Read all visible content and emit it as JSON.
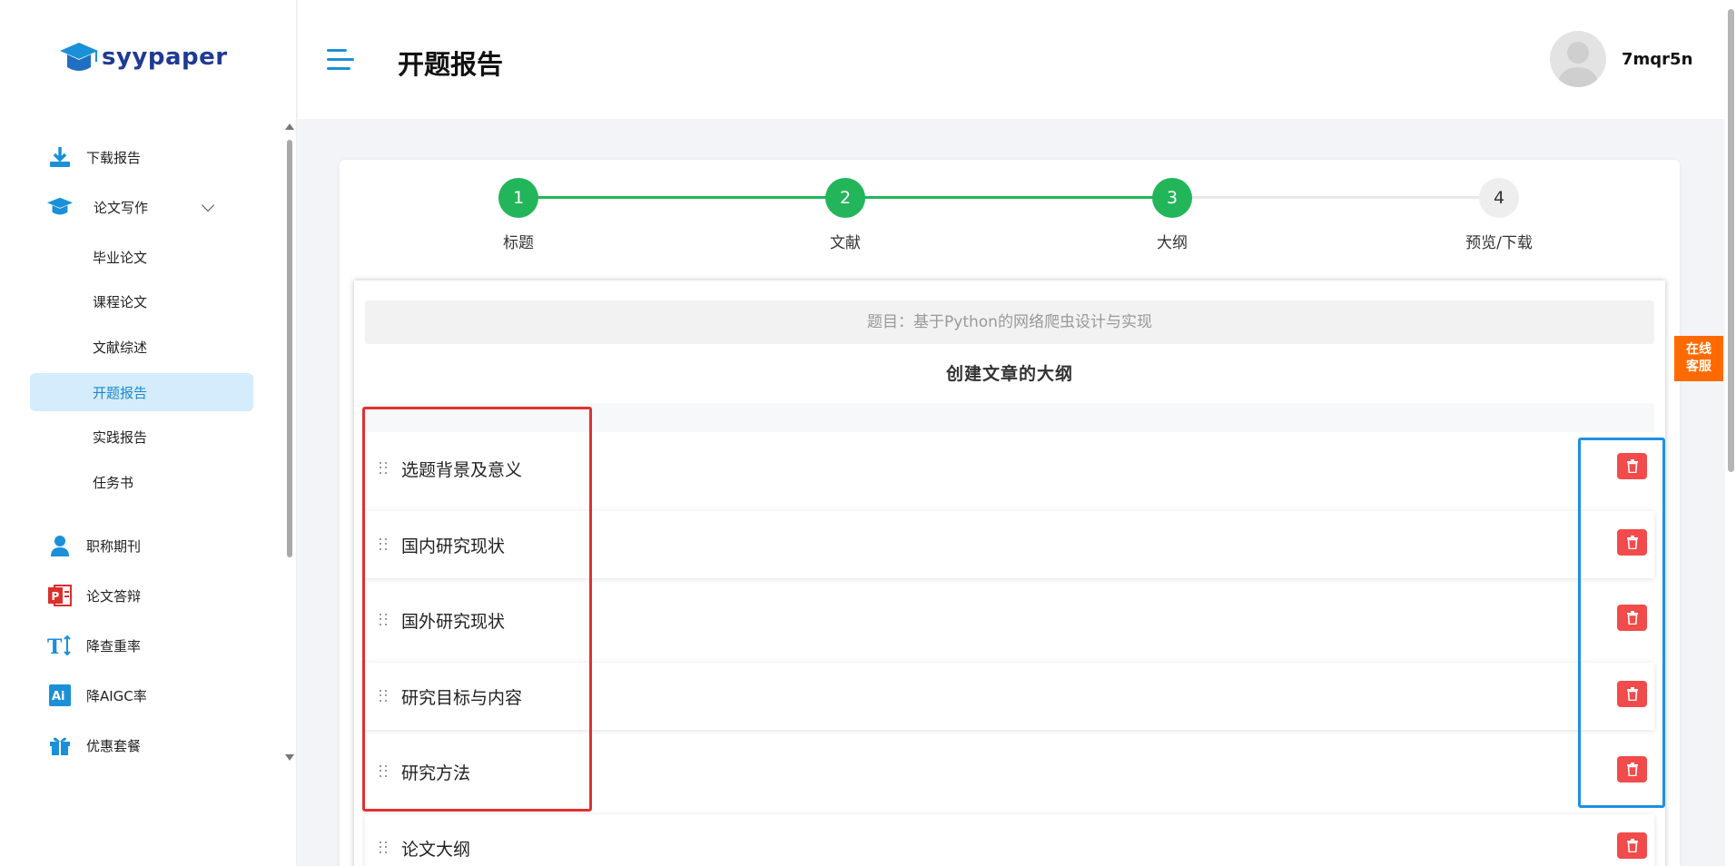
{
  "brand": {
    "name": "syypaper"
  },
  "sidebar": {
    "items": [
      {
        "label": "下载报告",
        "icon": "download-icon"
      },
      {
        "label": "论文写作",
        "icon": "graduation-cap-icon",
        "expanded": true
      },
      {
        "label": "职称期刊",
        "icon": "user-icon"
      },
      {
        "label": "论文答辩",
        "icon": "powerpoint-icon"
      },
      {
        "label": "降查重率",
        "icon": "text-height-icon"
      },
      {
        "label": "降AIGC率",
        "icon": "ai-icon"
      },
      {
        "label": "优惠套餐",
        "icon": "gift-icon"
      }
    ],
    "subitems": [
      {
        "label": "毕业论文"
      },
      {
        "label": "课程论文"
      },
      {
        "label": "文献综述"
      },
      {
        "label": "开题报告",
        "active": true
      },
      {
        "label": "实践报告"
      },
      {
        "label": "任务书"
      }
    ]
  },
  "header": {
    "title": "开题报告",
    "username": "7mqr5n"
  },
  "steps": [
    {
      "number": "1",
      "label": "标题",
      "done": true
    },
    {
      "number": "2",
      "label": "文献",
      "done": true
    },
    {
      "number": "3",
      "label": "大纲",
      "done": true
    },
    {
      "number": "4",
      "label": "预览/下载",
      "done": false
    }
  ],
  "outline": {
    "topic": "题目：基于Python的网络爬虫设计与实现",
    "heading": "创建文章的大纲",
    "rows": [
      {
        "label": "选题背景及意义"
      },
      {
        "label": "国内研究现状"
      },
      {
        "label": "国外研究现状"
      },
      {
        "label": "研究目标与内容"
      },
      {
        "label": "研究方法"
      },
      {
        "label": "论文大纲"
      }
    ]
  },
  "service": {
    "line1": "在线",
    "line2": "客服"
  },
  "colors": {
    "accent": "#1a90d8",
    "success": "#23b55a",
    "danger": "#f24b4b",
    "service": "#ff6a00",
    "active_bg": "#d4ecfb"
  }
}
